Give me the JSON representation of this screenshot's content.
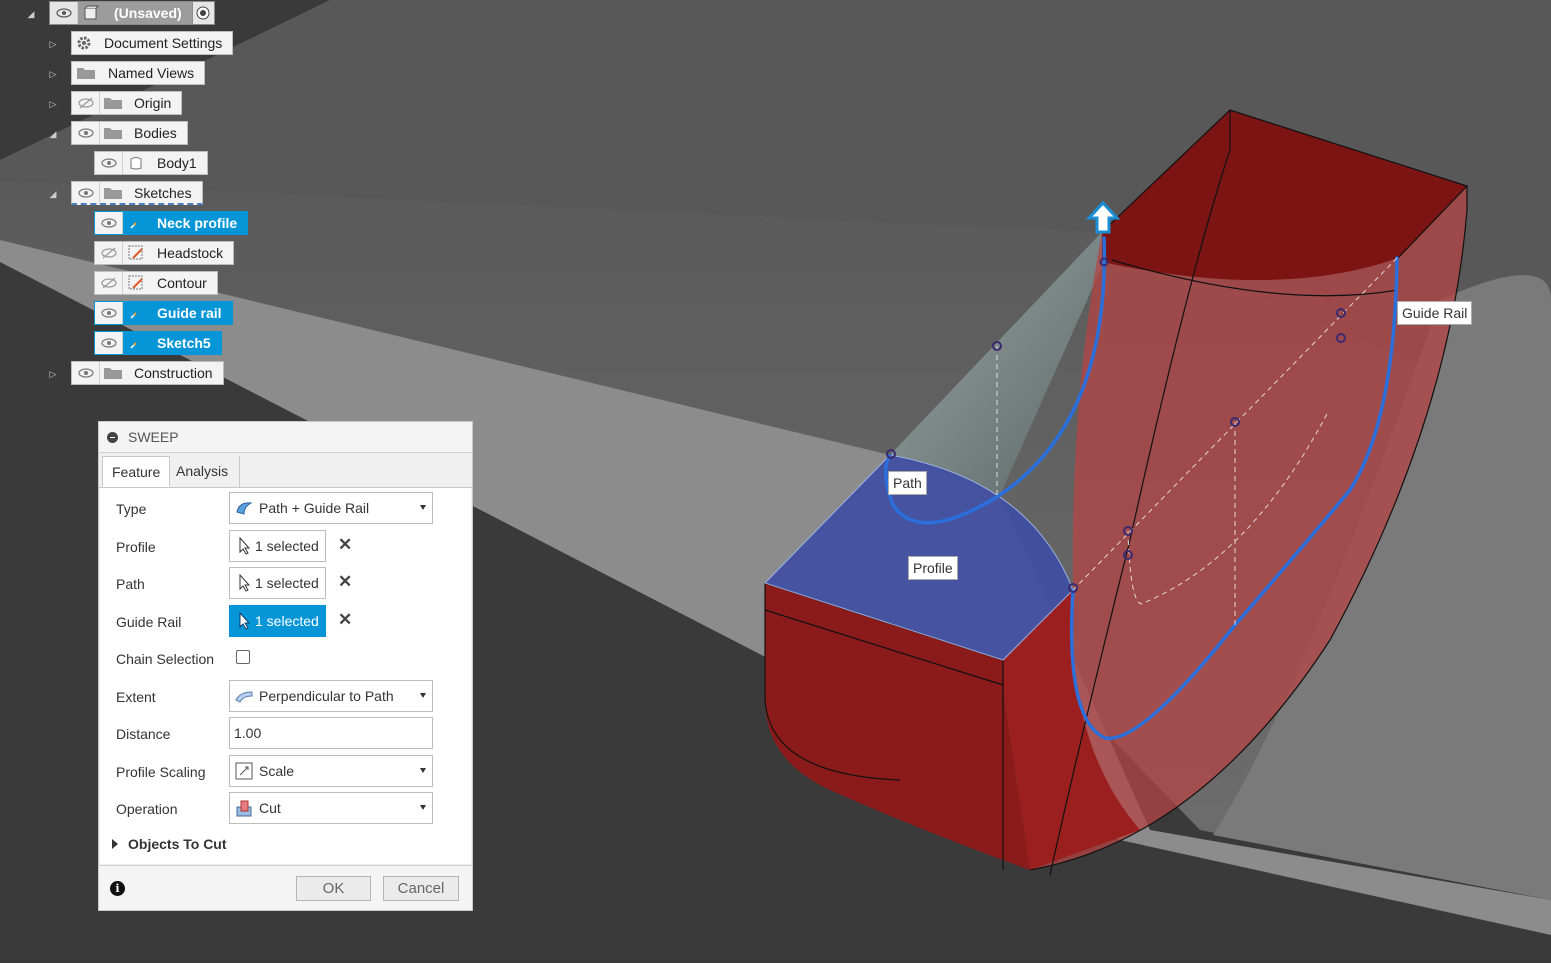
{
  "browser": {
    "root": {
      "label": "(Unsaved)"
    },
    "items": [
      {
        "label": "Document Settings"
      },
      {
        "label": "Named Views"
      },
      {
        "label": "Origin"
      },
      {
        "label": "Bodies"
      },
      {
        "label": "Body1"
      },
      {
        "label": "Sketches"
      },
      {
        "label": "Neck profile"
      },
      {
        "label": "Headstock"
      },
      {
        "label": "Contour"
      },
      {
        "label": "Guide rail"
      },
      {
        "label": "Sketch5"
      },
      {
        "label": "Construction"
      }
    ]
  },
  "sweep": {
    "title": "SWEEP",
    "tabs": [
      "Feature",
      "Analysis"
    ],
    "fields": {
      "type": {
        "label": "Type",
        "value": "Path + Guide Rail"
      },
      "profile": {
        "label": "Profile",
        "value": "1 selected"
      },
      "path": {
        "label": "Path",
        "value": "1 selected"
      },
      "guide_rail": {
        "label": "Guide Rail",
        "value": "1 selected"
      },
      "chain": {
        "label": "Chain Selection"
      },
      "extent": {
        "label": "Extent",
        "value": "Perpendicular to Path"
      },
      "distance": {
        "label": "Distance",
        "value": "1.00"
      },
      "scaling": {
        "label": "Profile Scaling",
        "value": "Scale"
      },
      "operation": {
        "label": "Operation",
        "value": "Cut"
      }
    },
    "objects_to_cut": "Objects To Cut",
    "info": "i",
    "ok": "OK",
    "cancel": "Cancel"
  },
  "canvas_labels": {
    "path": "Path",
    "profile": "Profile",
    "guide_rail": "Guide Rail"
  },
  "colors": {
    "accent": "#0696d7",
    "cut_body": "#8b1a1a",
    "profile_fill": "#3f4fa3",
    "path_curve": "#2a6fdb"
  }
}
